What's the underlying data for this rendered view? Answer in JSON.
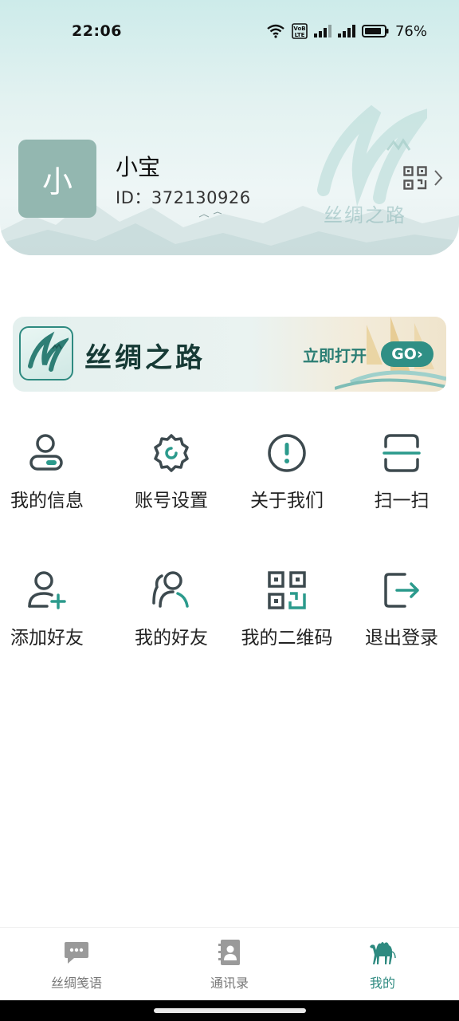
{
  "status_bar": {
    "time": "22:06",
    "battery": "76%",
    "network_badge": "VoB LTE"
  },
  "profile": {
    "avatar_text": "小",
    "name": "小宝",
    "id_text": "ID：372130926",
    "watermark": "丝绸之路"
  },
  "banner": {
    "title": "丝绸之路",
    "open_label": "立即打开",
    "go_label": "GO›"
  },
  "menu": {
    "row1": [
      {
        "label": "我的信息",
        "icon": "user-card-icon"
      },
      {
        "label": "账号设置",
        "icon": "gear-icon"
      },
      {
        "label": "关于我们",
        "icon": "info-circle-icon"
      },
      {
        "label": "扫一扫",
        "icon": "scan-icon"
      }
    ],
    "row2": [
      {
        "label": "添加好友",
        "icon": "add-user-icon"
      },
      {
        "label": "我的好友",
        "icon": "friends-icon"
      },
      {
        "label": "我的二维码",
        "icon": "qr-code-icon"
      },
      {
        "label": "退出登录",
        "icon": "logout-icon"
      }
    ]
  },
  "bottom_nav": {
    "items": [
      {
        "label": "丝绸笺语",
        "icon": "chat-bubble-icon",
        "active": false
      },
      {
        "label": "通讯录",
        "icon": "contacts-book-icon",
        "active": false
      },
      {
        "label": "我的",
        "icon": "camel-icon",
        "active": true
      }
    ]
  },
  "colors": {
    "accent": "#2e8a80",
    "avatar_bg": "#93b7b0",
    "icon_dark": "#3d4a4f",
    "icon_accent": "#2b9a8c"
  }
}
